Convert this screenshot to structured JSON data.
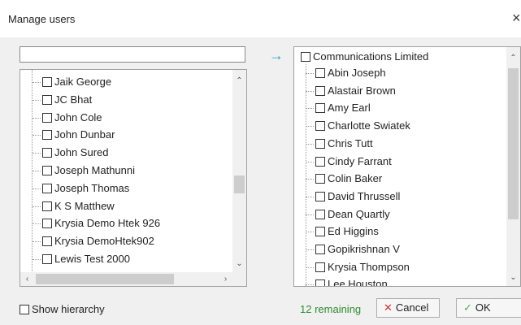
{
  "dialog": {
    "title": "Manage users",
    "close_glyph": "×"
  },
  "search": {
    "value": "",
    "placeholder": ""
  },
  "transfer_arrow": "→",
  "left_list": {
    "items": [
      "Jaik George",
      "JC Bhat",
      "John Cole",
      "John Dunbar",
      "John Sured",
      "Joseph Mathunni",
      "Joseph Thomas",
      "K S Matthew",
      "Krysia Demo Htek 926",
      "Krysia DemoHtek902",
      "Lewis Test 2000"
    ]
  },
  "right_list": {
    "group": "Communications Limited",
    "items": [
      "Abin Joseph",
      "Alastair Brown",
      "Amy Earl",
      "Charlotte Swiatek",
      "Chris Tutt",
      "Cindy Farrant",
      "Colin Baker",
      "David Thrussell",
      "Dean Quartly",
      "Ed Higgins",
      "Gopikrishnan V",
      "Krysia Thompson",
      "Lee Houston"
    ]
  },
  "footer": {
    "show_hierarchy": "Show hierarchy",
    "remaining": "12 remaining",
    "cancel": "Cancel",
    "ok": "OK"
  },
  "colors": {
    "accent": "#2b9cd8",
    "remaining": "#2e8b2e",
    "cancel_icon": "#d9302c",
    "ok_icon": "#4caf50"
  }
}
